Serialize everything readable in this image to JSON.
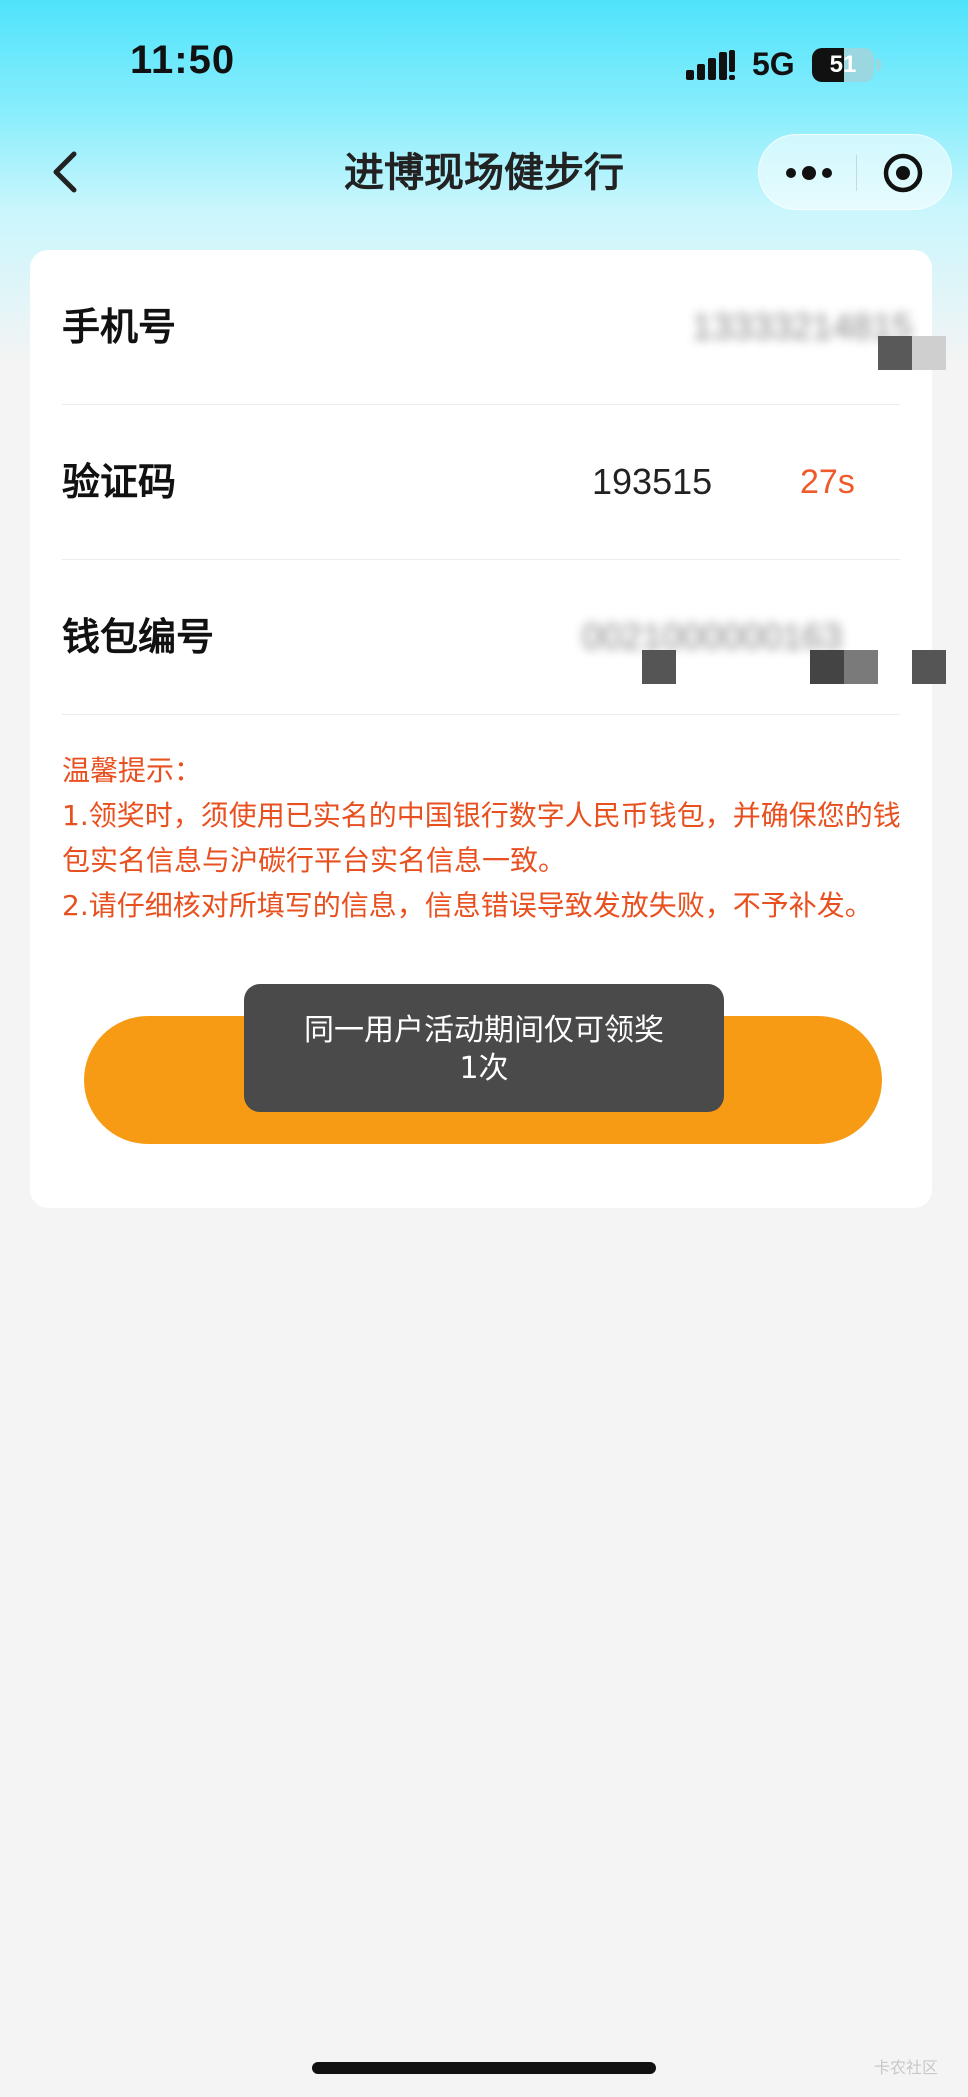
{
  "status_bar": {
    "time": "11:50",
    "network": "5G",
    "battery": "51",
    "battery_fraction": 0.51,
    "icons": [
      "signal-icon",
      "battery-icon"
    ]
  },
  "nav": {
    "title": "进博现场健步行",
    "icons": [
      "chevron-left-icon",
      "more-dots-icon",
      "target-close-icon"
    ]
  },
  "form": {
    "phone": {
      "label": "手机号",
      "value": "13333214815"
    },
    "code": {
      "label": "验证码",
      "value": "193515",
      "countdown": "27s"
    },
    "wallet": {
      "label": "钱包编号",
      "value": "0021000000163"
    }
  },
  "tips": {
    "title": "温馨提示：",
    "line1": "1.领奖时，须使用已实名的中国银行数字人民币钱包，并确保您的钱包实名信息与沪碳行平台实名信息一致。",
    "line2": "2.请仔细核对所填写的信息，信息错误导致发放失败，不予补发。"
  },
  "toast": {
    "line1": "同一用户活动期间仅可领奖",
    "line2": "1次"
  },
  "watermark": "卡农社区",
  "colors": {
    "accent": "#f89b14",
    "warning_text": "#e8501f",
    "header_top": "#4fe3fb"
  }
}
